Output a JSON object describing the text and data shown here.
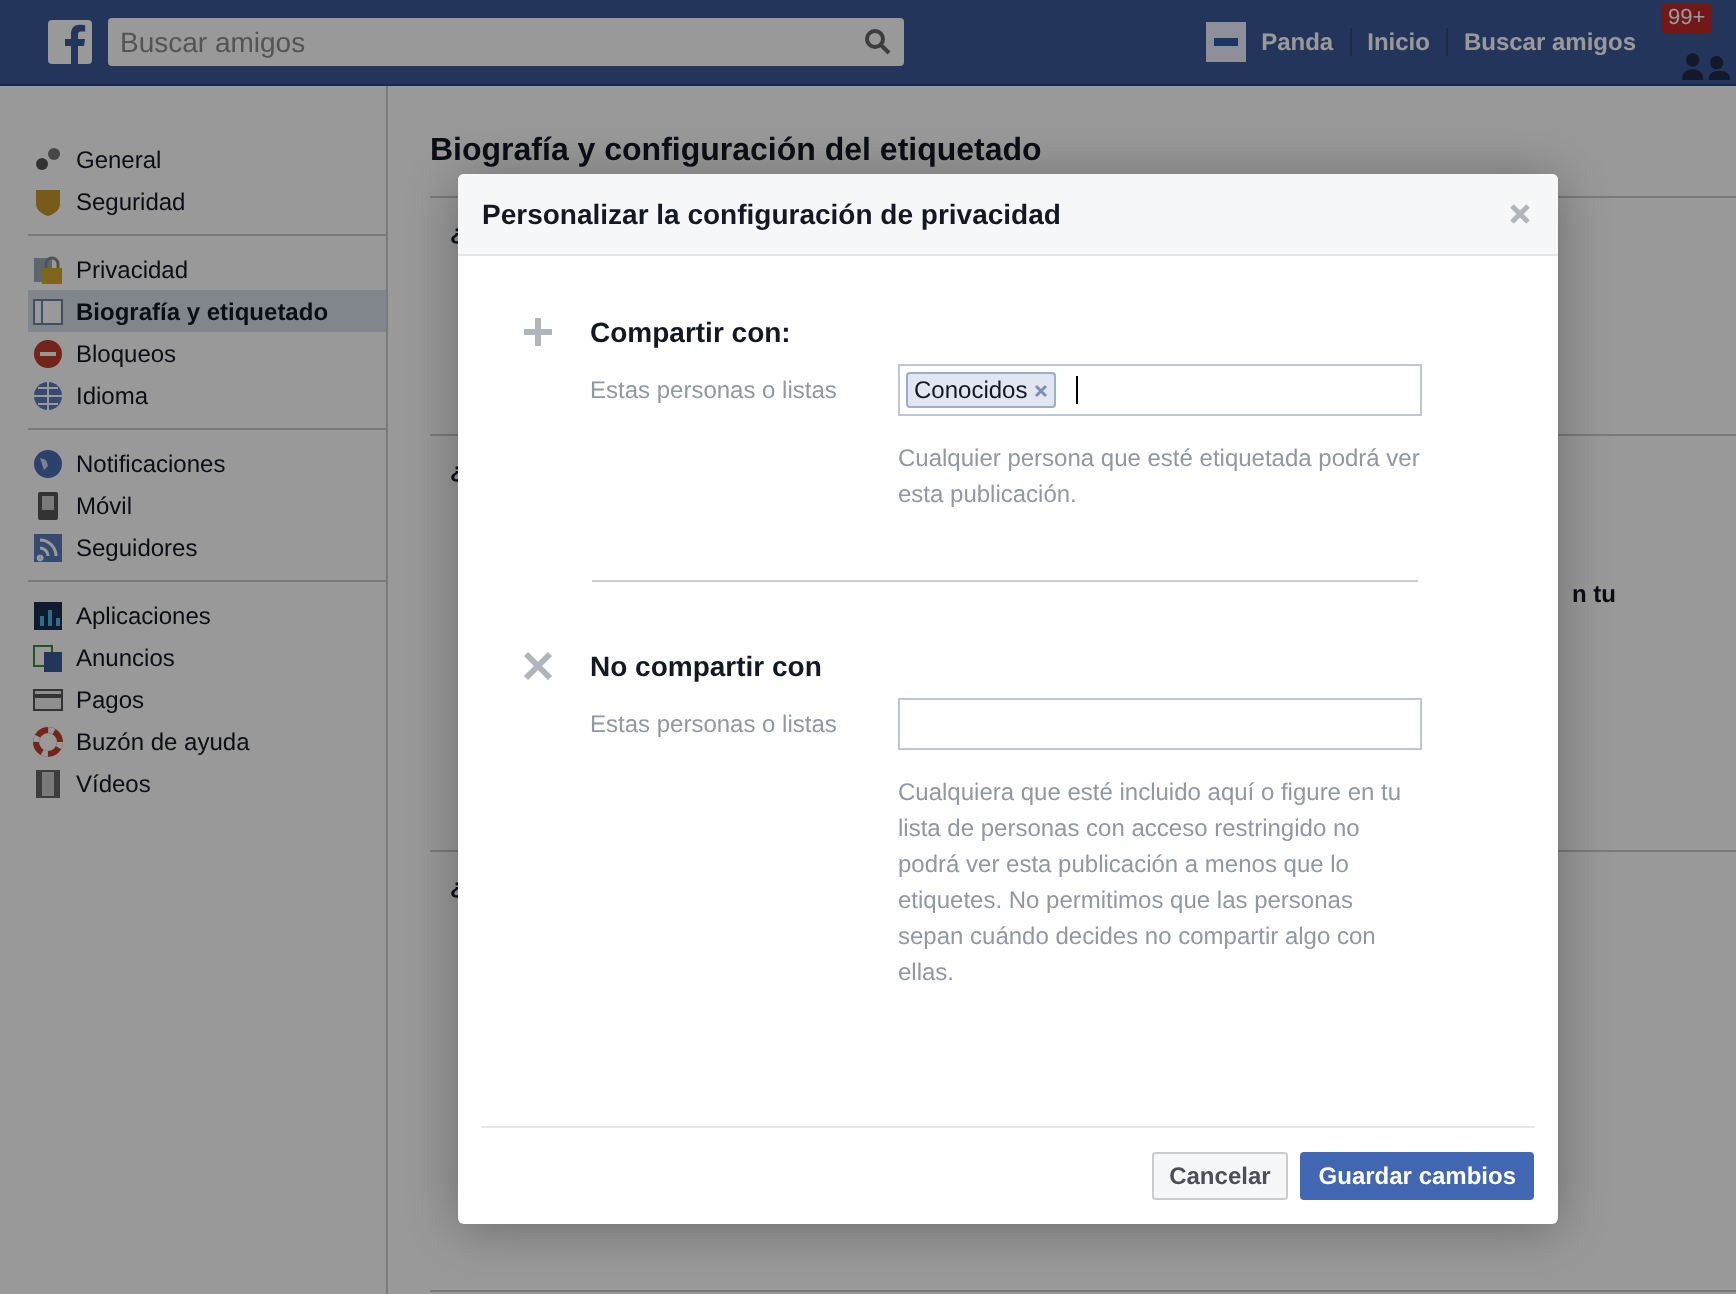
{
  "topbar": {
    "search": {
      "placeholder": "Buscar amigos"
    },
    "nav": [
      {
        "label": "Panda",
        "avatar": true
      },
      {
        "label": "Inicio",
        "avatar": false
      },
      {
        "label": "Buscar amigos",
        "avatar": false
      }
    ],
    "badge": "99+"
  },
  "sidebar": {
    "groups": [
      [
        {
          "label": "General",
          "selected": false
        },
        {
          "label": "Seguridad",
          "selected": false
        }
      ],
      [
        {
          "label": "Privacidad",
          "selected": false
        },
        {
          "label": "Biografía y etiquetado",
          "selected": true
        },
        {
          "label": "Bloqueos",
          "selected": false
        },
        {
          "label": "Idioma",
          "selected": false
        }
      ],
      [
        {
          "label": "Notificaciones",
          "selected": false
        },
        {
          "label": "Móvil",
          "selected": false
        },
        {
          "label": "Seguidores",
          "selected": false
        }
      ],
      [
        {
          "label": "Aplicaciones",
          "selected": false
        },
        {
          "label": "Anuncios",
          "selected": false
        },
        {
          "label": "Pagos",
          "selected": false
        },
        {
          "label": "Buzón de ayuda",
          "selected": false
        },
        {
          "label": "Vídeos",
          "selected": false
        }
      ]
    ]
  },
  "main": {
    "title": "Biografía y configuración del etiquetado",
    "rows": [
      {
        "lines": [
          "¿"
        ]
      },
      {
        "lines": [
          "¿"
        ],
        "right": "n tu"
      },
      {
        "lines": [
          "¿"
        ]
      }
    ]
  },
  "dialog": {
    "title": "Personalizar la configuración de privacidad",
    "sections": [
      {
        "kind": "include",
        "heading": "Compartir con:",
        "label": "Estas personas o listas",
        "tokens": [
          "Conocidos"
        ],
        "help": "Cualquier persona que esté etiquetada podrá ver esta publicación."
      },
      {
        "kind": "exclude",
        "heading": "No compartir con",
        "label": "Estas personas o listas",
        "help": "Cualquiera que esté incluido aquí o figure en tu lista de personas con acceso restringido no podrá ver esta publicación a menos que lo etiquetes. No permitimos que las personas sepan cuándo decides no compartir algo con ellas."
      }
    ],
    "buttons": [
      {
        "label": "Cancelar",
        "primary": false
      },
      {
        "label": "Guardar cambios",
        "primary": true
      }
    ]
  }
}
